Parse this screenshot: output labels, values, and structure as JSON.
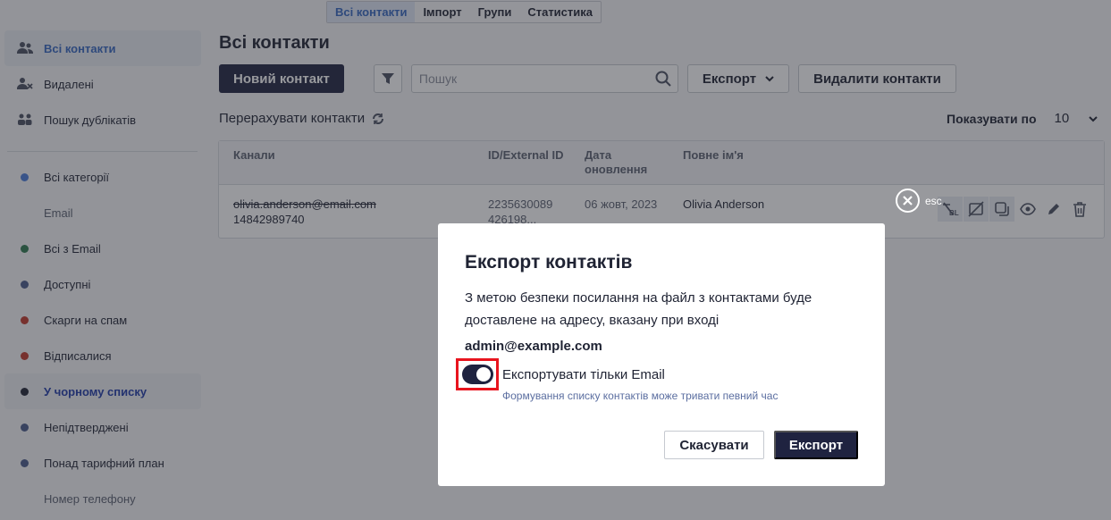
{
  "top_tabs": [
    "Всі контакти",
    "Імпорт",
    "Групи",
    "Статистика"
  ],
  "sidebar": {
    "items": [
      {
        "label": "Всі контакти"
      },
      {
        "label": "Видалені"
      },
      {
        "label": "Пошук дублікатів"
      }
    ],
    "categories": [
      {
        "label": "Всі категорії",
        "color": "#4a7bd8"
      },
      {
        "label": "Email",
        "sub": true
      },
      {
        "label": "Всі з Email",
        "color": "#2f7a4f"
      },
      {
        "label": "Доступні",
        "color": "#4a5a8a"
      },
      {
        "label": "Скарги на спам",
        "color": "#c0392b"
      },
      {
        "label": "Відписалися",
        "color": "#c0392b"
      },
      {
        "label": "У чорному списку",
        "color": "#1f2333"
      },
      {
        "label": "Непідтверджені",
        "color": "#4a5a8a"
      },
      {
        "label": "Понад тарифний план",
        "color": "#4a5a8a"
      },
      {
        "label": "Номер телефону",
        "sub": true
      }
    ]
  },
  "main": {
    "title": "Всі контакти",
    "new_contact": "Новий контакт",
    "search_placeholder": "Пошук",
    "export": "Експорт",
    "delete_contacts": "Видалити контакти",
    "recount": "Перерахувати контакти",
    "show_label": "Показувати по",
    "show_value": "10"
  },
  "table": {
    "headers": [
      "Канали",
      "ID/External ID",
      "Дата оновлення",
      "Повне ім'я"
    ],
    "rows": [
      {
        "email": "olivia.anderson@email.com",
        "phone": "14842989740",
        "id_line1": "2235630089",
        "id_line2": "426198...",
        "date": "06 жовт, 2023",
        "name": "Olivia Anderson"
      }
    ]
  },
  "modal": {
    "esc": "esc",
    "title": "Експорт контактів",
    "text": "З метою безпеки посилання на файл з контактами буде доставлене на адресу, вказану при вході",
    "email": "admin@example.com",
    "toggle_label": "Експортувати тільки Email",
    "toggle_on": true,
    "hint": "Формування списку контактів може тривати певний час",
    "cancel": "Скасувати",
    "confirm": "Експорт"
  }
}
